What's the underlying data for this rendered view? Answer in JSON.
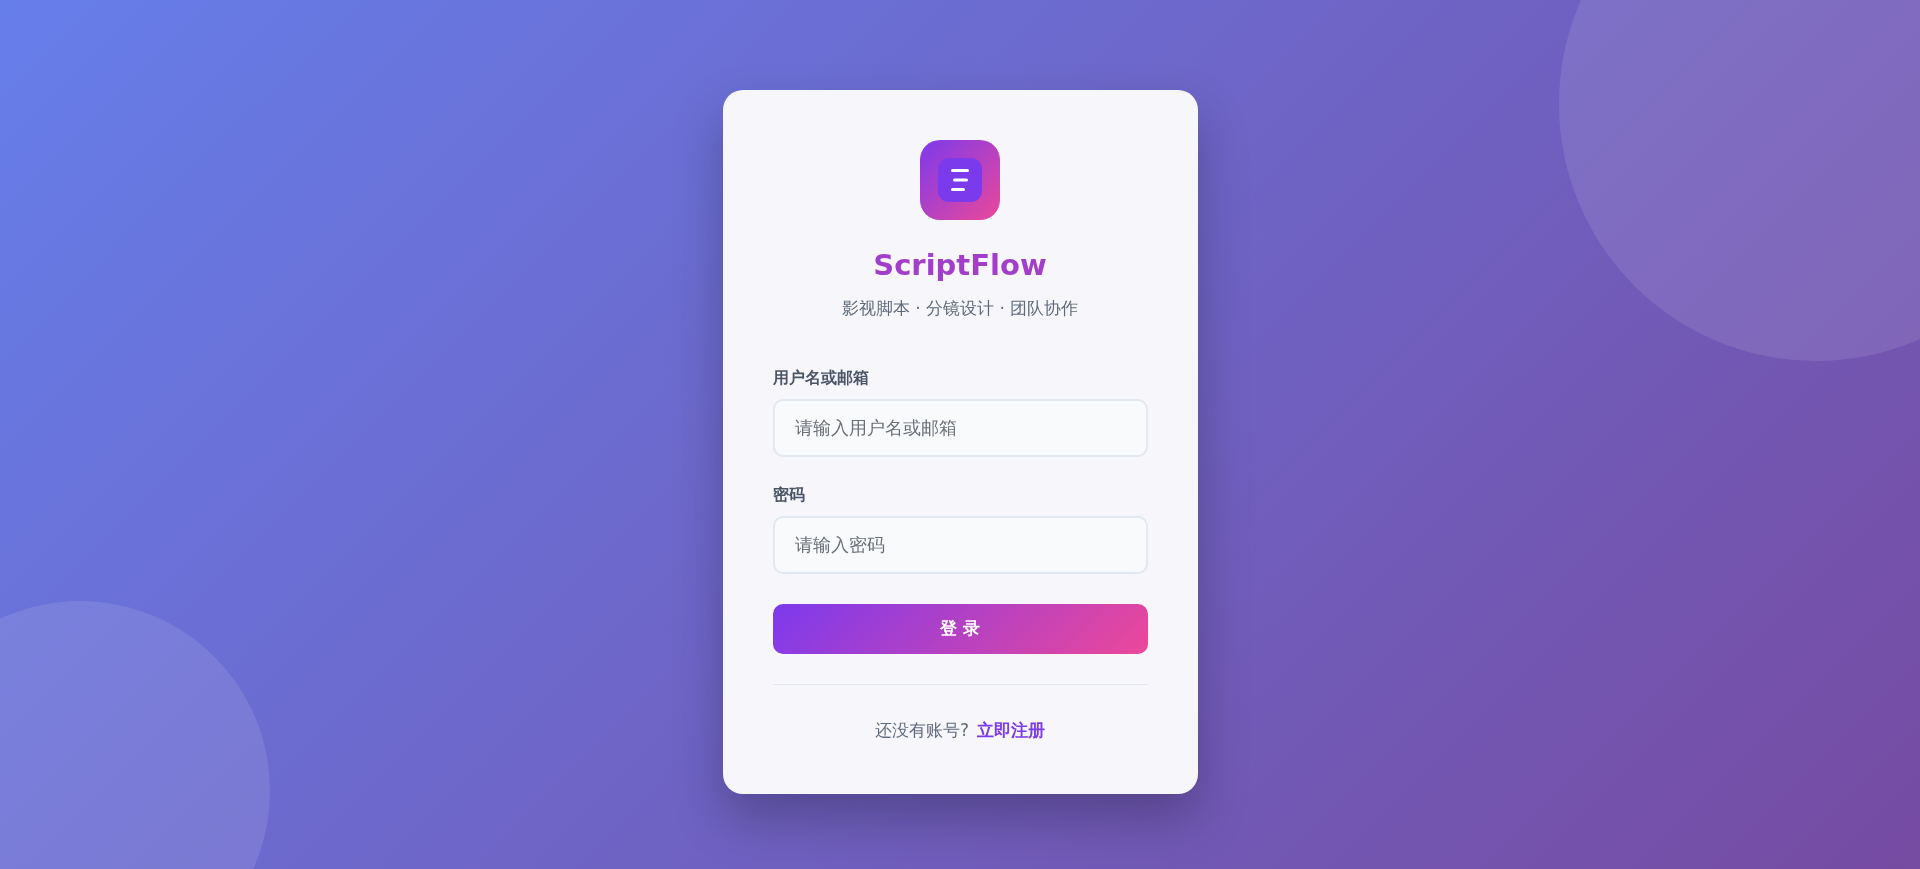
{
  "brand": {
    "name": "ScriptFlow",
    "tagline": "影视脚本 · 分镜设计 · 团队协作"
  },
  "fields": [
    {
      "label": "用户名或邮箱",
      "placeholder": "请输入用户名或邮箱"
    },
    {
      "label": "密码",
      "placeholder": "请输入密码"
    }
  ],
  "submit": {
    "label": "登 录"
  },
  "footer": {
    "prompt": "还没有账号?",
    "link": "立即注册"
  }
}
